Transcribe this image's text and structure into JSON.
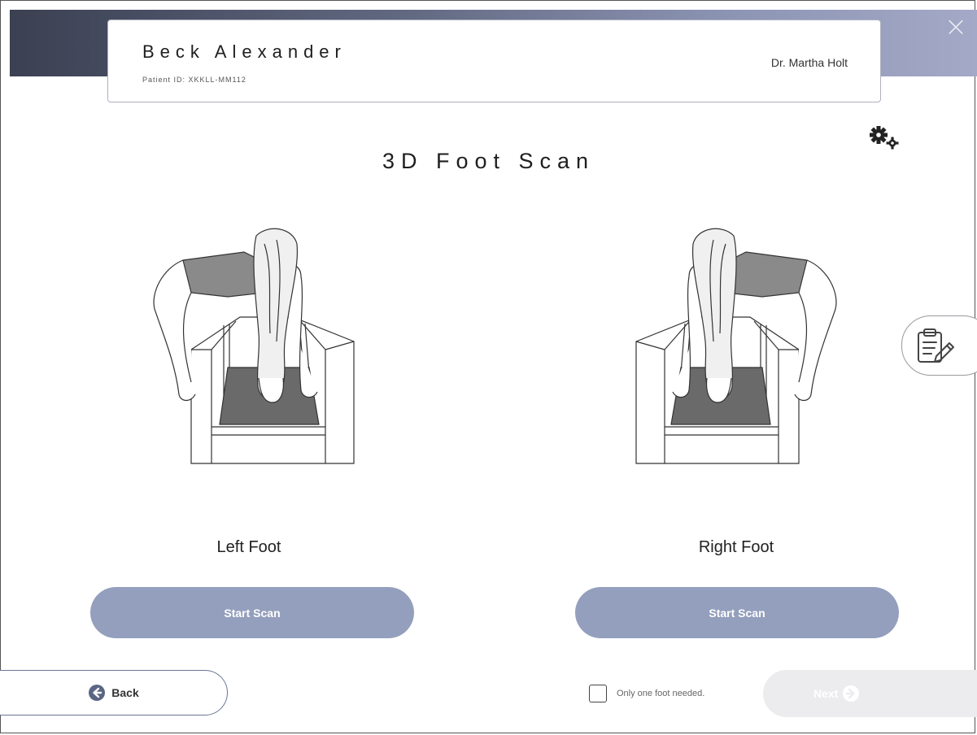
{
  "window": {
    "close_label": "×"
  },
  "patient": {
    "name": "Beck Alexander",
    "id_text": "Patient ID: XKKLL-MM112",
    "doctor": "Dr. Martha Holt"
  },
  "page": {
    "title": "3D Foot Scan"
  },
  "left": {
    "label": "Left Foot",
    "button": "Start Scan"
  },
  "right": {
    "label": "Right Foot",
    "button": "Start Scan"
  },
  "footer": {
    "back_label": "Back",
    "only_one_label": "Only one foot needed.",
    "next_label": "Next"
  },
  "icons": {
    "settings": "gears-icon",
    "notes": "clipboard-edit-icon",
    "back": "arrow-left-circle-icon",
    "next": "arrow-right-circle-icon",
    "close": "close-icon"
  },
  "colors": {
    "header_start": "#3b4052",
    "header_end": "#a3a9c6",
    "button": "#949fbd",
    "next_disabled": "#ececef"
  }
}
